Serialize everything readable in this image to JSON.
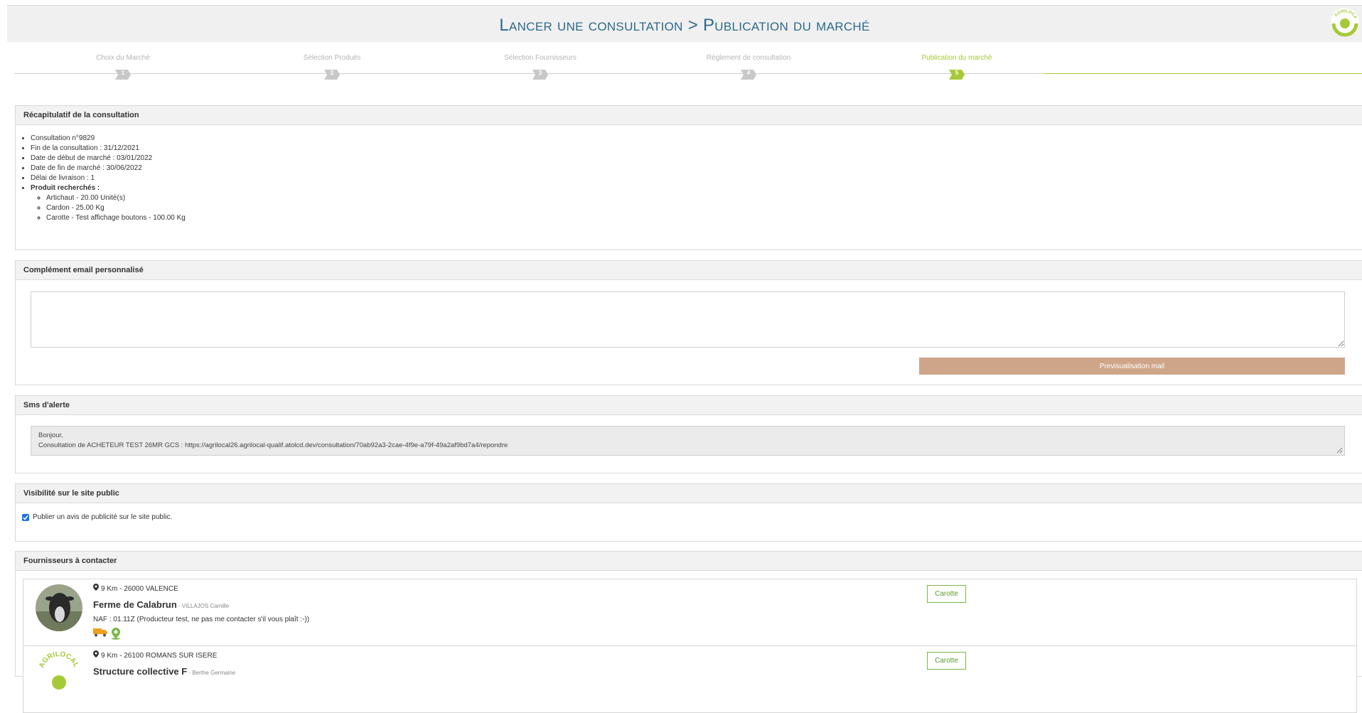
{
  "header": {
    "title": "Lancer une consultation > Publication du marché",
    "logo_text": "AGRILOCAL"
  },
  "stepper": {
    "steps": [
      {
        "label": "Choix du Marché",
        "number": "1",
        "active": false
      },
      {
        "label": "Sélection Produits",
        "number": "2",
        "active": false
      },
      {
        "label": "Sélection Fournisseurs",
        "number": "3",
        "active": false
      },
      {
        "label": "Règlement de consultation",
        "number": "4",
        "active": false
      },
      {
        "label": "Publication du marché",
        "number": "5",
        "active": true
      }
    ]
  },
  "recap": {
    "title": "Récapitulatif de la consultation",
    "items": [
      "Consultation n°9829",
      "Fin de la consultation : 31/12/2021",
      "Date de début de marché : 03/01/2022",
      "Date de fin de marché : 30/06/2022",
      "Délai de livraison : 1"
    ],
    "products_label": "Produit recherchés :",
    "products": [
      "Artichaut - 20.00 Unité(s)",
      "Cardon - 25.00 Kg",
      "Carotte - Test affichage boutons - 100.00 Kg"
    ]
  },
  "email": {
    "title": "Complément email personnalisé",
    "value": "",
    "preview_button": "Previsualisation mail"
  },
  "sms": {
    "title": "Sms d'alerte",
    "line1": "Bonjour,",
    "line2": "Consultation de ACHETEUR TEST 26MR GCS : https://agrilocal26.agrilocal-qualif.atolcd.dev/consultation/70ab92a3-2cae-4f9e-a79f-49a2af9bd7a4/repondre"
  },
  "visibility": {
    "title": "Visibilité sur le site public",
    "checkbox_label": "Publier un avis de publicité sur le site public.",
    "checked": true
  },
  "suppliers": {
    "title": "Fournisseurs à contacter",
    "items": [
      {
        "distance": "9 Km",
        "separator": " - ",
        "location": "26000 VALENCE",
        "name": "Ferme de Calabrun",
        "contact": " - VILLAJOS Camille",
        "naf": "NAF : 01.11Z (Producteur test, ne pas me contacter s'il vous plaît :-))",
        "product": "Carotte"
      },
      {
        "distance": "9 Km",
        "separator": " - ",
        "location": "26100 ROMANS SUR ISERE",
        "name": "Structure collective F",
        "contact": " - Berthe Germaine",
        "naf": "",
        "product": "Carotte"
      }
    ]
  },
  "colors": {
    "title_blue": "#2d6a8a",
    "active_green": "#a6c93a",
    "preview_button": "#cfa58a",
    "product_tag_green": "#7ab648"
  }
}
